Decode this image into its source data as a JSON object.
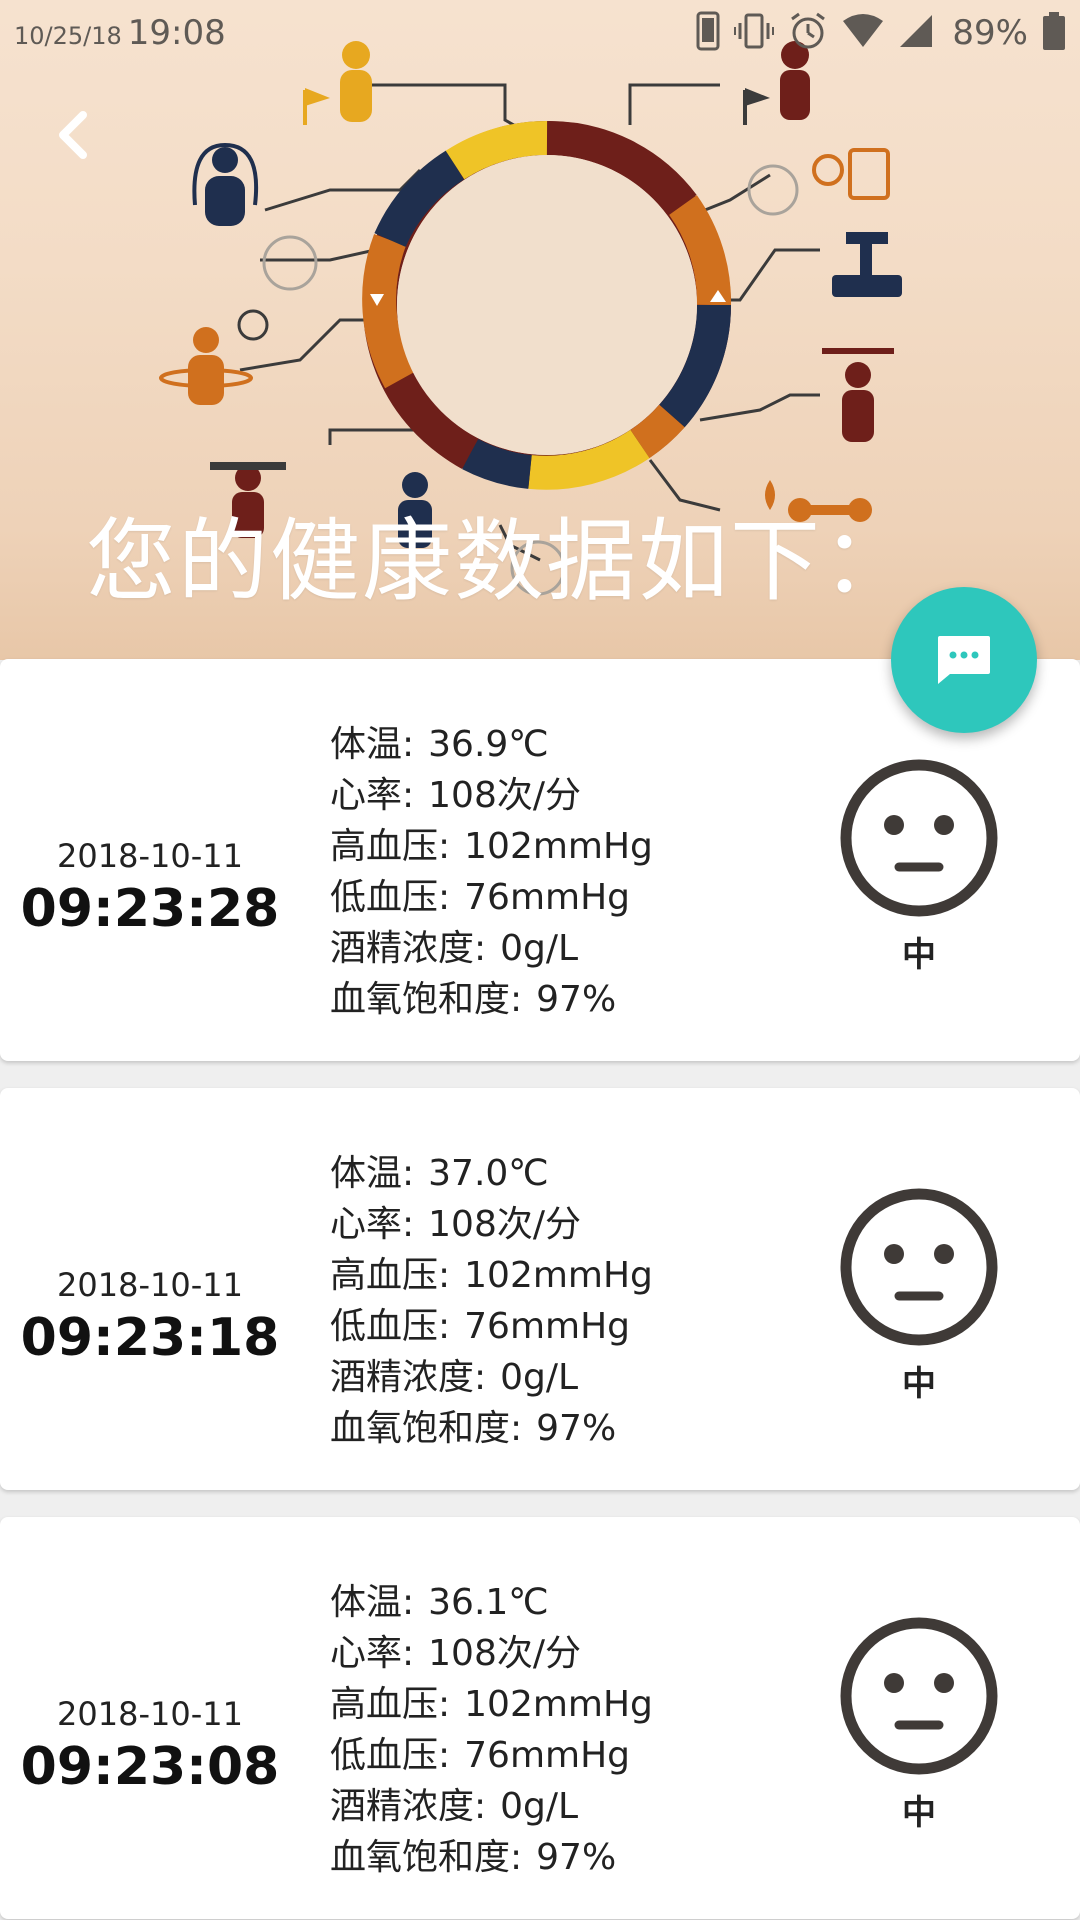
{
  "status_bar": {
    "date": "10/25/18",
    "time": "19:08",
    "battery": "89%",
    "icons": [
      "phone-icon",
      "vibrate-icon",
      "alarm-icon",
      "wifi-icon",
      "signal-icon",
      "battery-icon"
    ]
  },
  "header": {
    "title": "您的健康数据如下：",
    "back_icon": "chevron-left-icon"
  },
  "fab": {
    "icon": "chat-bubble-icon",
    "color": "#2ec7bc"
  },
  "records": [
    {
      "date": "2018-10-11",
      "time": "09:23:28",
      "metrics": [
        {
          "label": "体温:",
          "value": "36.9℃"
        },
        {
          "label": "心率:",
          "value": "108次/分"
        },
        {
          "label": "高血压:",
          "value": "102mmHg"
        },
        {
          "label": "低血压:",
          "value": "76mmHg"
        },
        {
          "label": "酒精浓度:",
          "value": "0g/L"
        },
        {
          "label": "血氧饱和度:",
          "value": "97%"
        }
      ],
      "face_icon": "neutral-face-icon",
      "grade": "中"
    },
    {
      "date": "2018-10-11",
      "time": "09:23:18",
      "metrics": [
        {
          "label": "体温:",
          "value": "37.0℃"
        },
        {
          "label": "心率:",
          "value": "108次/分"
        },
        {
          "label": "高血压:",
          "value": "102mmHg"
        },
        {
          "label": "低血压:",
          "value": "76mmHg"
        },
        {
          "label": "酒精浓度:",
          "value": "0g/L"
        },
        {
          "label": "血氧饱和度:",
          "value": "97%"
        }
      ],
      "face_icon": "neutral-face-icon",
      "grade": "中"
    },
    {
      "date": "2018-10-11",
      "time": "09:23:08",
      "metrics": [
        {
          "label": "体温:",
          "value": "36.1℃"
        },
        {
          "label": "心率:",
          "value": "108次/分"
        },
        {
          "label": "高血压:",
          "value": "102mmHg"
        },
        {
          "label": "低血压:",
          "value": "76mmHg"
        },
        {
          "label": "酒精浓度:",
          "value": "0g/L"
        },
        {
          "label": "血氧饱和度:",
          "value": "97%"
        }
      ],
      "face_icon": "neutral-face-icon",
      "grade": "中"
    }
  ],
  "colors": {
    "accent": "#2ec7bc",
    "ring_dark_red": "#6e1f1a",
    "ring_navy": "#1f2f4e",
    "ring_orange": "#d0701e",
    "ring_yellow": "#efc427",
    "face_stroke": "#3f3a37"
  }
}
